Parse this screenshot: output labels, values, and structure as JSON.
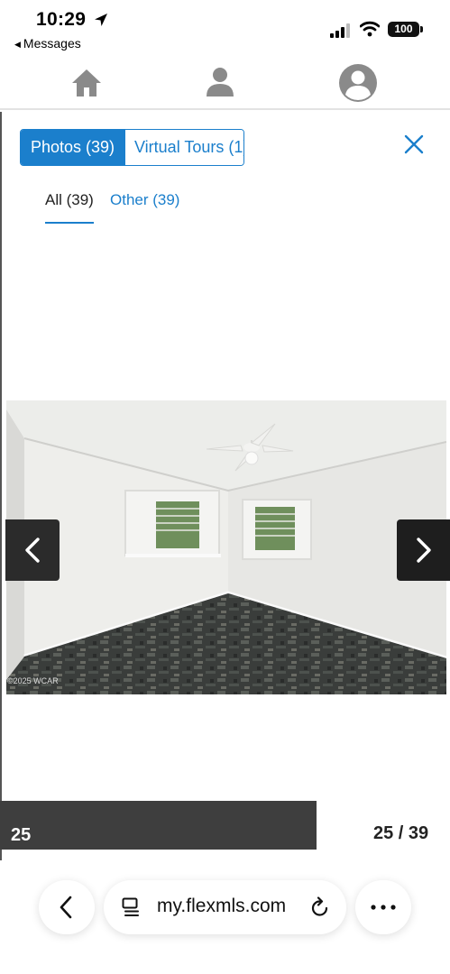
{
  "status_bar": {
    "time": "10:29",
    "back_app": "Messages",
    "battery": "100"
  },
  "app_nav": {
    "home_icon": "home-icon",
    "contact_icon": "person-icon",
    "account_icon": "account-circle-icon"
  },
  "gallery": {
    "tabs": [
      {
        "label": "Photos (39)",
        "active": true
      },
      {
        "label": "Virtual Tours (1)",
        "active": false
      }
    ],
    "subtabs": [
      {
        "label": "All (39)",
        "active": true
      },
      {
        "label": "Other (39)",
        "active": false
      }
    ],
    "photo_watermark": "©2025 WCAR",
    "caption_number": "25",
    "counter": "25 / 39"
  },
  "browser": {
    "url": "my.flexmls.com"
  },
  "colors": {
    "accent": "#1b7fcc",
    "caption_bar": "#3e3e3e",
    "arrow_bg": "#2b2b2b"
  }
}
